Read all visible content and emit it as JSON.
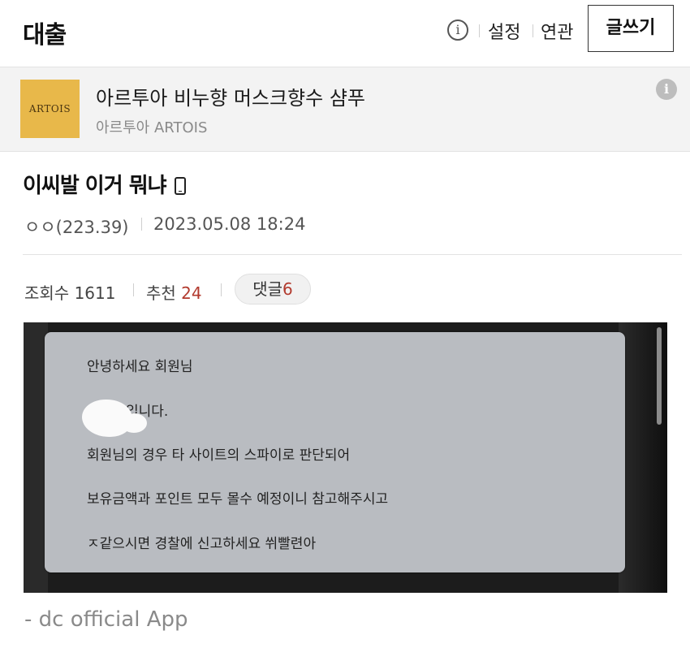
{
  "header": {
    "title": "대출",
    "info_glyph": "i",
    "settings_label": "설정",
    "related_label": "연관",
    "write_label": "글쓰기"
  },
  "ad": {
    "logo_text": "ARTOIS",
    "title": "아르투아 비누향 머스크향수 샴푸",
    "brand": "아르투아 ARTOIS",
    "info_glyph": "i"
  },
  "post": {
    "title": "이씨발 이거 뭐냐",
    "author": "ㅇㅇ(223.39)",
    "date": "2023.05.08 18:24",
    "views_label": "조회수",
    "views": "1611",
    "recommend_label": "추천",
    "recommend": "24",
    "comments_label": "댓글",
    "comments": "6"
  },
  "image": {
    "lines": [
      "안녕하세요 회원님",
      "입니다.",
      "회원님의 경우 타 사이트의 스파이로 판단되어",
      "보유금액과 포인트 모두 몰수 예정이니 참고해주시고",
      "ㅈ같으시면 경찰에 신고하세요 쒸빨련아"
    ]
  },
  "footer": {
    "text": "- dc official App"
  },
  "colors": {
    "accent_red": "#b23a2e",
    "logo_bg": "#e8b84a"
  }
}
